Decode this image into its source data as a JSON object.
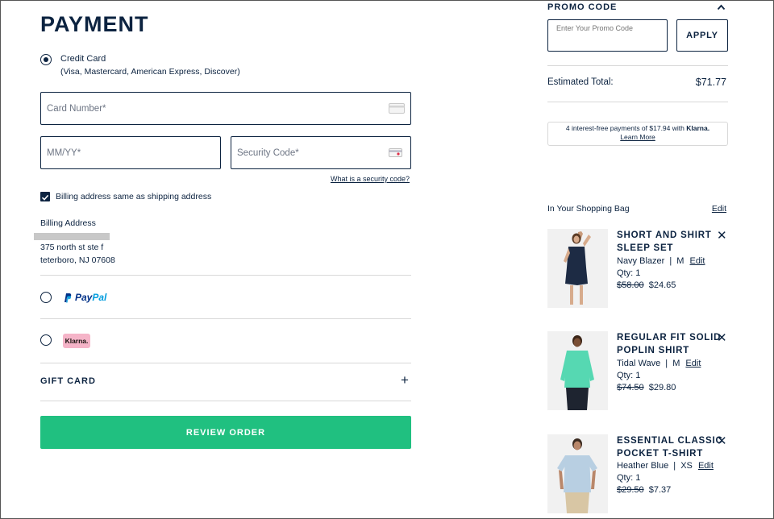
{
  "payment": {
    "title": "PAYMENT",
    "credit_card": {
      "label": "Credit Card",
      "sublabel": "(Visa, Mastercard, American Express, Discover)",
      "card_number_placeholder": "Card Number*",
      "expiry_placeholder": "MM/YY*",
      "security_placeholder": "Security Code*",
      "security_link": "What is a security code?"
    },
    "billing_same_label": "Billing address same as shipping address",
    "billing_address": {
      "heading": "Billing Address",
      "line1": "375 north st ste f",
      "line2": "teterboro, NJ 07608"
    },
    "paypal": {
      "pay": "Pay",
      "pal": "Pal"
    },
    "klarna_badge": "Klarna.",
    "gift_card": "GIFT CARD",
    "review_button": "REVIEW ORDER"
  },
  "summary": {
    "promo_heading": "PROMO CODE",
    "promo_placeholder": "Enter Your Promo Code",
    "apply_button": "APPLY",
    "estimated_total_label": "Estimated Total:",
    "estimated_total_value": "$71.77",
    "klarna_text": "4 interest-free payments of $17.94 with",
    "klarna_brand": "Klarna.",
    "klarna_learn_more": "Learn More",
    "bag_heading": "In Your Shopping Bag",
    "bag_edit": "Edit"
  },
  "items": [
    {
      "name_line1": "SHORT AND SHIRT",
      "name_line2": "SLEEP SET",
      "color": "Navy Blazer",
      "sep": "|",
      "size": "M",
      "edit": "Edit",
      "qty": "Qty: 1",
      "was": "$58.00",
      "now": "$24.65"
    },
    {
      "name_line1": "REGULAR FIT SOLID",
      "name_line2": "POPLIN SHIRT",
      "color": "Tidal Wave",
      "sep": "|",
      "size": "M",
      "edit": "Edit",
      "qty": "Qty: 1",
      "was": "$74.50",
      "now": "$29.80"
    },
    {
      "name_line1": "ESSENTIAL CLASSIC",
      "name_line2": "POCKET T-SHIRT",
      "color": "Heather Blue",
      "sep": "|",
      "size": "XS",
      "edit": "Edit",
      "qty": "Qty: 1",
      "was": "$29.50",
      "now": "$7.37"
    }
  ],
  "colors": {
    "navy": "#0c2340",
    "green": "#20c080",
    "klarna_pink": "#f5b4c8",
    "paypal_dark": "#003087",
    "paypal_light": "#009cde"
  }
}
